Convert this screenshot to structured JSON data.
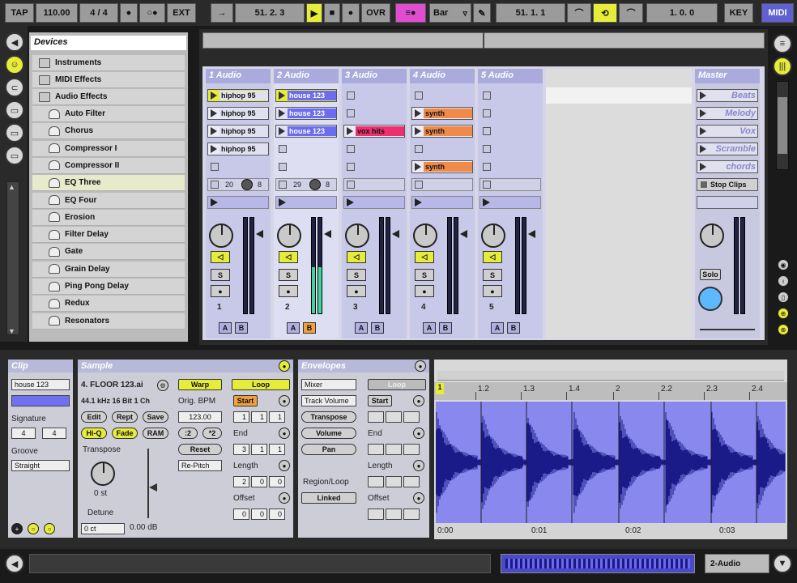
{
  "transport": {
    "tap": "TAP",
    "tempo": "110.00",
    "sig_num": "4",
    "sig_den": "4",
    "ext": "EXT",
    "position": "51.  2.  3",
    "ovr": "OVR",
    "quant": "Bar",
    "loop_start": "51.  1.  1",
    "loop_len": "1.  0.  0",
    "key": "KEY",
    "midi": "MIDI"
  },
  "browser": {
    "title": "Devices",
    "folders": [
      "Instruments",
      "MIDI Effects",
      "Audio Effects"
    ],
    "items": [
      "Auto Filter",
      "Chorus",
      "Compressor I",
      "Compressor II",
      "EQ Three",
      "EQ Four",
      "Erosion",
      "Filter Delay",
      "Gate",
      "Grain Delay",
      "Ping Pong Delay",
      "Redux",
      "Resonators"
    ],
    "selected": "EQ Three"
  },
  "tracks": [
    {
      "name": "1 Audio",
      "number": "1",
      "clips": [
        "hiphop 95",
        "hiphop 95",
        "hiphop 95",
        "hiphop 95",
        ""
      ],
      "send_a": "20",
      "send_b": "8"
    },
    {
      "name": "2 Audio",
      "number": "2",
      "clips": [
        "house 123",
        "house 123",
        "house 123",
        "",
        ""
      ],
      "send_a": "29",
      "send_b": "8"
    },
    {
      "name": "3 Audio",
      "number": "3",
      "clips": [
        "",
        "",
        "vox hits",
        "",
        ""
      ]
    },
    {
      "name": "4 Audio",
      "number": "4",
      "clips": [
        "",
        "synth",
        "synth",
        "",
        "synth"
      ]
    },
    {
      "name": "5 Audio",
      "number": "5",
      "clips": [
        "",
        "",
        "",
        "",
        ""
      ]
    }
  ],
  "master": {
    "name": "Master",
    "scenes": [
      "Beats",
      "Melody",
      "Vox",
      "Scramble",
      "chords"
    ],
    "stop_clips": "Stop Clips",
    "solo": "Solo"
  },
  "strip_buttons": {
    "a": "A",
    "b": "B",
    "s": "S"
  },
  "clip_view": {
    "title": "Clip",
    "clip_name": "house 123",
    "signature_label": "Signature",
    "sig_num": "4",
    "sig_den": "4",
    "groove_label": "Groove",
    "groove_value": "Straight"
  },
  "sample": {
    "title": "Sample",
    "file": "4. FLOOR 123.ai",
    "format": "44.1 kHz 16 Bit 1 Ch",
    "edit": "Edit",
    "rept": "Rept",
    "save": "Save",
    "hiq": "Hi-Q",
    "fade": "Fade",
    "ram": "RAM",
    "transpose_label": "Transpose",
    "transpose_value": "0 st",
    "detune_label": "Detune",
    "detune_value": "0 ct",
    "volume_value": "0.00 dB",
    "warp": "Warp",
    "orig_bpm_label": "Orig. BPM",
    "orig_bpm": "123.00",
    "half": ":2",
    "double": "*2",
    "reset": "Reset",
    "mode": "Re-Pitch",
    "loop": "Loop",
    "start": "Start",
    "start_vals": [
      "1",
      "1",
      "1"
    ],
    "end_label": "End",
    "end_vals": [
      "3",
      "1",
      "1"
    ],
    "length_label": "Length",
    "length_vals": [
      "2",
      "0",
      "0"
    ],
    "offset_label": "Offset",
    "offset_vals": [
      "0",
      "0",
      "0"
    ]
  },
  "envelopes": {
    "title": "Envelopes",
    "device": "Mixer",
    "param": "Track Volume",
    "transpose": "Transpose",
    "volume": "Volume",
    "pan": "Pan",
    "region_label": "Region/Loop",
    "linked": "Linked",
    "loop": "Loop",
    "start": "Start",
    "end": "End",
    "length": "Length",
    "offset": "Offset"
  },
  "waveform": {
    "markers": [
      "1",
      "1.2",
      "1.3",
      "1.4",
      "2",
      "2.2",
      "2.3",
      "2.4"
    ],
    "times": [
      "0:00",
      "0:01",
      "0:02",
      "0:03"
    ]
  },
  "statusbar": {
    "track": "2-Audio"
  }
}
